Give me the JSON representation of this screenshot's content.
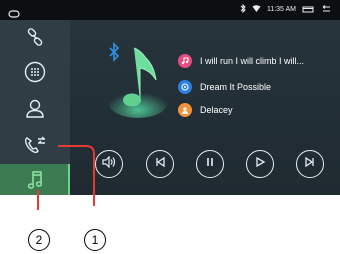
{
  "status": {
    "time": "11:35 AM"
  },
  "sidebar": {
    "items": [
      {
        "name": "bluetooth-link",
        "icon": "link-icon"
      },
      {
        "name": "dialpad",
        "icon": "dialpad-icon"
      },
      {
        "name": "contacts",
        "icon": "contact-icon"
      },
      {
        "name": "call-log",
        "icon": "phone-transfer-icon"
      },
      {
        "name": "music",
        "icon": "music-note-icon",
        "active": true
      }
    ]
  },
  "player": {
    "tracks": [
      {
        "text": "I will run I will climb I will...",
        "icon": "music-note-icon",
        "color": "#e84b82"
      },
      {
        "text": "Dream It Possible",
        "icon": "disc-icon",
        "color": "#2f7fe0"
      },
      {
        "text": "Delacey",
        "icon": "artist-icon",
        "color": "#f1913a"
      }
    ]
  },
  "callouts": [
    "2",
    "1"
  ],
  "colors": {
    "accent": "#6fd28b",
    "sidebar": "#2f3d45",
    "main": "#1f2a32"
  }
}
